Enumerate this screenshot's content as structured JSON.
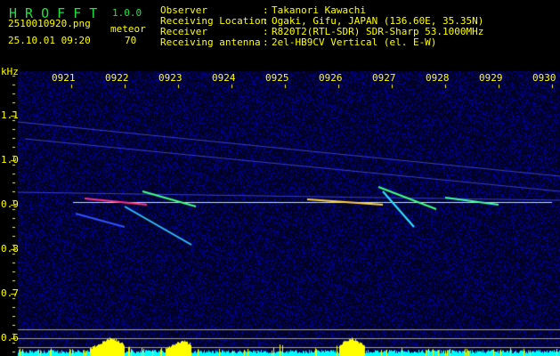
{
  "header": {
    "app_name": "H R O F F T",
    "version": "1.0.0",
    "filename": "2510010920.png",
    "datetime": "25.10.01 09:20",
    "meteor_label": "meteor",
    "meteor_count": "70",
    "info": [
      {
        "label": "Observer",
        "value": "Takanori Kawachi"
      },
      {
        "label": "Receiving Location",
        "value": "Ogaki, Gifu, JAPAN (136.60E, 35.35N)"
      },
      {
        "label": "Receiver",
        "value": "R820T2(RTL-SDR) SDR-Sharp 53.1000MHz"
      },
      {
        "label": "Receiving antenna",
        "value": "2el-HB9CV Vertical (el. E-W)"
      }
    ]
  },
  "chart_data": {
    "type": "heatmap",
    "ylabel": "kHz",
    "y_ticks": [
      "1.1",
      "1.0",
      "0.9",
      "0.8",
      "0.7",
      "0.6"
    ],
    "y_tick_values": [
      1.1,
      1.0,
      0.9,
      0.8,
      0.7,
      0.6
    ],
    "x_ticks": [
      "0921",
      "0922",
      "0923",
      "0924",
      "0925",
      "0926",
      "0927",
      "0928",
      "0929",
      "0930"
    ],
    "ylim": [
      0.56,
      1.2
    ],
    "carrier_khz": 0.905,
    "colors": {
      "background_noise": "#0a0a60",
      "text": "#ffff00",
      "title": "#20e040",
      "activity_high": "#ffff00",
      "activity_low": "#00ffff"
    }
  }
}
